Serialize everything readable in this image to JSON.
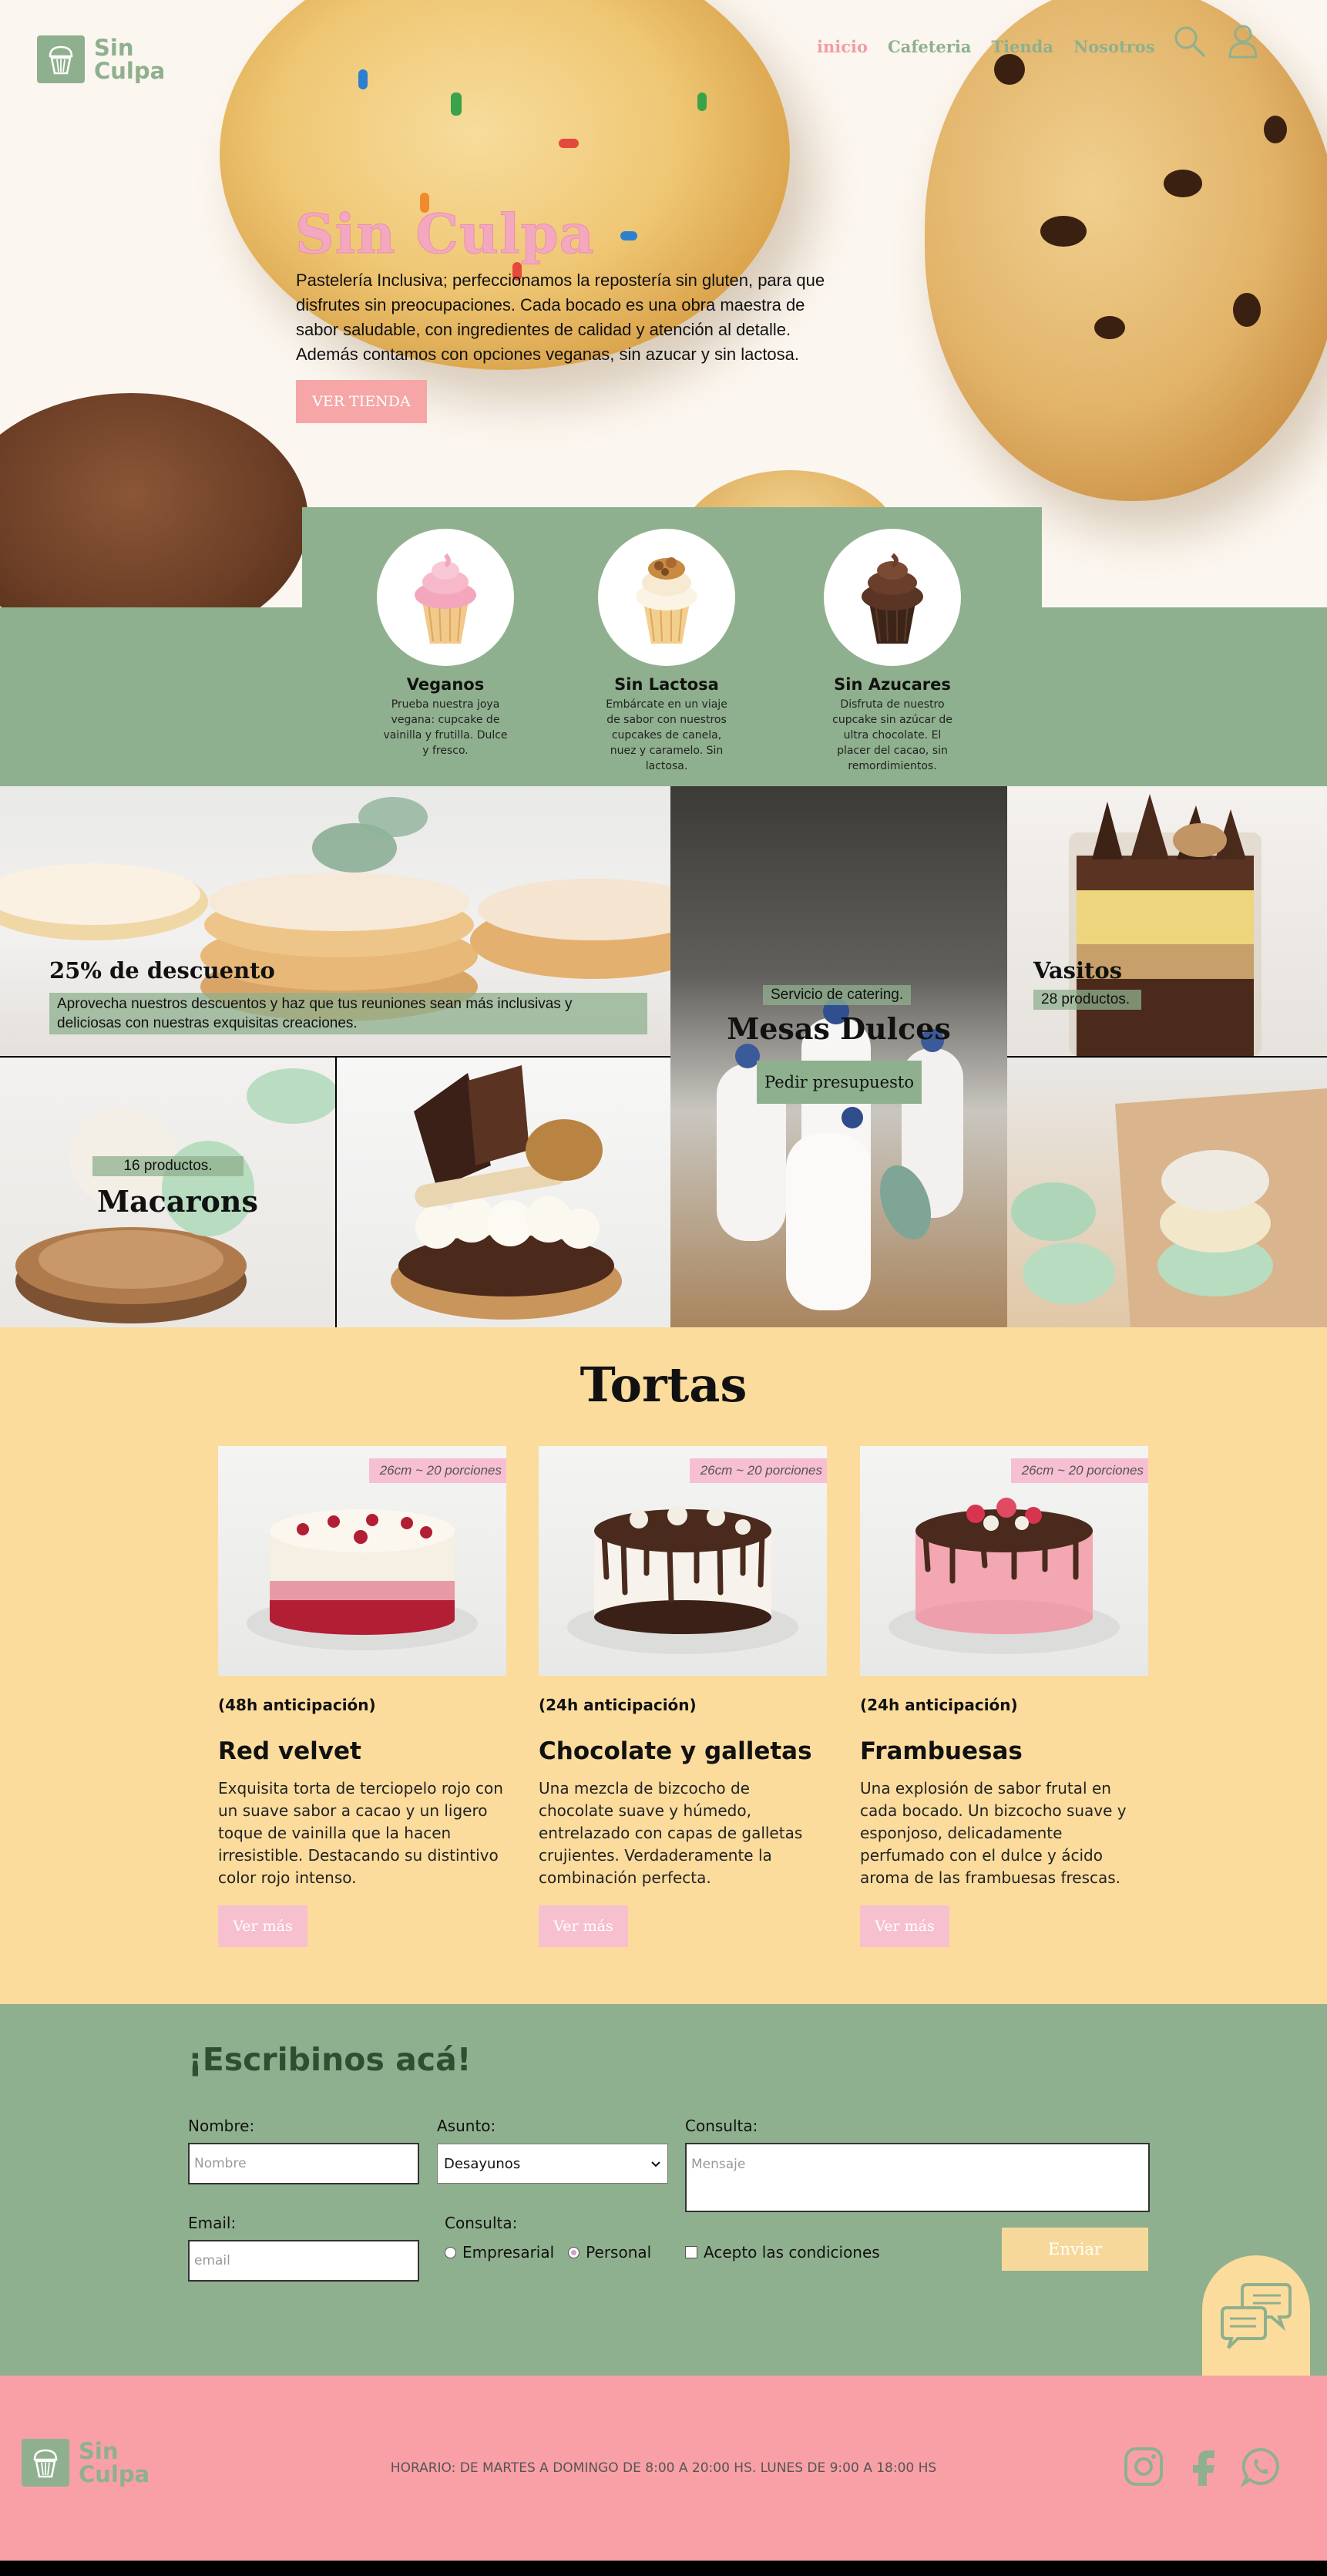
{
  "brand": {
    "name_line1": "Sin",
    "name_line2": "Culpa"
  },
  "nav": {
    "items": [
      {
        "label": "inicio",
        "active": true
      },
      {
        "label": "Cafeteria",
        "active": false
      },
      {
        "label": "Tienda",
        "active": false
      },
      {
        "label": "Nosotros",
        "active": false
      }
    ],
    "icons": [
      "search-icon",
      "user-icon"
    ]
  },
  "hero": {
    "title": "Sin Culpa",
    "text": "Pastelería Inclusiva; perfeccionamos la repostería sin gluten, para que disfrutes sin preocupaciones. Cada bocado es una obra maestra de sabor saludable, con ingredientes de calidad y atención al detalle. Además contamos con opciones veganas, sin azucar y sin lactosa.",
    "button": "VER TIENDA"
  },
  "features": [
    {
      "title": "Veganos",
      "desc": "Prueba nuestra joya vegana: cupcake de vainilla y frutilla. Dulce y fresco.",
      "icon": "pink-cupcake-icon"
    },
    {
      "title": "Sin Lactosa",
      "desc": "Embárcate en un viaje de sabor con nuestros cupcakes de canela, nuez y caramelo. Sin lactosa.",
      "icon": "caramel-cupcake-icon"
    },
    {
      "title": "Sin Azucares",
      "desc": "Disfruta de nuestro cupcake sin azúcar de ultra chocolate. El placer del cacao, sin remordimientos.",
      "icon": "chocolate-cupcake-icon"
    }
  ],
  "gallery": {
    "descuento": {
      "title": "25% de descuento",
      "text": "Aprovecha nuestros descuentos y haz que tus reuniones sean más inclusivas y deliciosas con nuestras exquisitas creaciones."
    },
    "mesas": {
      "tag": "Servicio de catering.",
      "title": "Mesas Dulces",
      "button": "Pedir presupuesto"
    },
    "vasitos": {
      "title": "Vasitos",
      "tag": "28 productos."
    },
    "macarons": {
      "tag": "16 productos.",
      "title": "Macarons"
    }
  },
  "tortas": {
    "title": "Tortas",
    "cards": [
      {
        "size": "26cm ~ 20 porciones",
        "advance": "(48h anticipación)",
        "name": "Red velvet",
        "desc": "Exquisita torta de terciopelo rojo con un suave sabor a cacao y un ligero toque de vainilla que la hacen irresistible. Destacando su distintivo color rojo intenso.",
        "button": "Ver más"
      },
      {
        "size": "26cm ~ 20 porciones",
        "advance": "(24h anticipación)",
        "name": "Chocolate y galletas",
        "desc": "Una mezcla de bizcocho de chocolate suave y húmedo, entrelazado con capas de galletas crujientes. Verdaderamente la combinación perfecta.",
        "button": "Ver más"
      },
      {
        "size": "26cm ~ 20 porciones",
        "advance": "(24h anticipación)",
        "name": "Frambuesas",
        "desc": "Una explosión de sabor frutal en cada bocado. Un bizcocho suave y esponjoso, delicadamente perfumado con el dulce y ácido aroma de las frambuesas frescas.",
        "button": "Ver más"
      }
    ]
  },
  "contact": {
    "title": "¡Escribinos acá!",
    "nombre_label": "Nombre:",
    "nombre_placeholder": "Nombre",
    "asunto_label": "Asunto:",
    "asunto_value": "Desayunos",
    "consulta_label": "Consulta:",
    "consulta_placeholder": "Mensaje",
    "email_label": "Email:",
    "email_placeholder": "email",
    "tipo_label": "Consulta:",
    "tipo_options": [
      "Empresarial",
      "Personal"
    ],
    "tipo_selected": "Personal",
    "conditions": "Acepto las condiciones",
    "send": "Enviar"
  },
  "footer": {
    "hours": "HORARIO: DE MARTES A DOMINGO DE 8:00 A 20:00 HS. LUNES DE 9:00 A 18:00 HS",
    "social": [
      "instagram-icon",
      "facebook-icon",
      "whatsapp-icon"
    ]
  },
  "colors": {
    "green": "#8fb08e",
    "pink": "#f8a0a6",
    "yellow": "#fbdc9d",
    "title_pink": "#f4a8c0"
  }
}
